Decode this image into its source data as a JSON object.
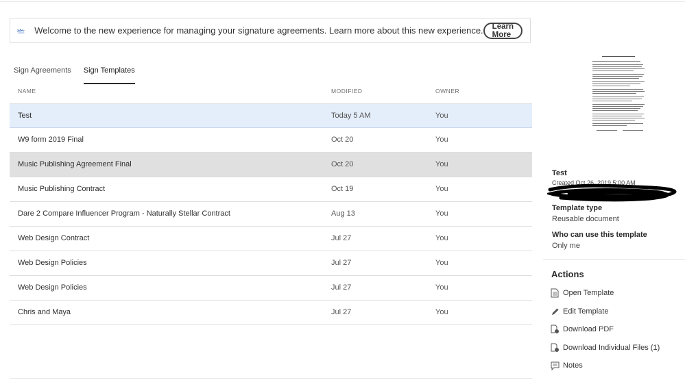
{
  "banner": {
    "icon": "signature-icon",
    "message": "Welcome to the new experience for managing your signature agreements. Learn more about this new experience.",
    "button_label": "Learn More"
  },
  "tabs": [
    {
      "label": "Sign Agreements",
      "active": false
    },
    {
      "label": "Sign Templates",
      "active": true
    }
  ],
  "table": {
    "columns": [
      "NAME",
      "MODIFIED",
      "OWNER"
    ],
    "rows": [
      {
        "name": "Test",
        "modified": "Today 5 AM",
        "owner": "You"
      },
      {
        "name": "W9 form 2019 Final",
        "modified": "Oct 20",
        "owner": "You"
      },
      {
        "name": "Music Publishing Agreement Final",
        "modified": "Oct 20",
        "owner": "You"
      },
      {
        "name": "Music Publishing Contract",
        "modified": "Oct 19",
        "owner": "You"
      },
      {
        "name": "Dare 2 Compare Influencer Program - Naturally Stellar Contract",
        "modified": "Aug 13",
        "owner": "You"
      },
      {
        "name": "Web Design Contract",
        "modified": "Jul 27",
        "owner": "You"
      },
      {
        "name": "Web Design Policies",
        "modified": "Jul 27",
        "owner": "You"
      },
      {
        "name": "Web Design Policies",
        "modified": "Jul 27",
        "owner": "You"
      },
      {
        "name": "Chris and Maya",
        "modified": "Jul 27",
        "owner": "You"
      }
    ],
    "selected_index": 0,
    "hovered_index": 2
  },
  "details": {
    "title": "Test",
    "created": "Created Oct 26, 2019 5:00 AM",
    "template_type_label": "Template type",
    "template_type_value": "Reusable document",
    "who_label": "Who can use this template",
    "who_value": "Only me"
  },
  "actions": {
    "title": "Actions",
    "items": [
      {
        "label": "Open Template",
        "icon": "document-icon"
      },
      {
        "label": "Edit Template",
        "icon": "pencil-icon"
      },
      {
        "label": "Download PDF",
        "icon": "download-pdf-icon"
      },
      {
        "label": "Download Individual Files (1)",
        "icon": "download-files-icon"
      },
      {
        "label": "Notes",
        "icon": "notes-icon"
      }
    ]
  },
  "colors": {
    "selected_row": "#e4edfa",
    "hover_row": "#e0e0e0",
    "text": "#2c2c2c"
  }
}
